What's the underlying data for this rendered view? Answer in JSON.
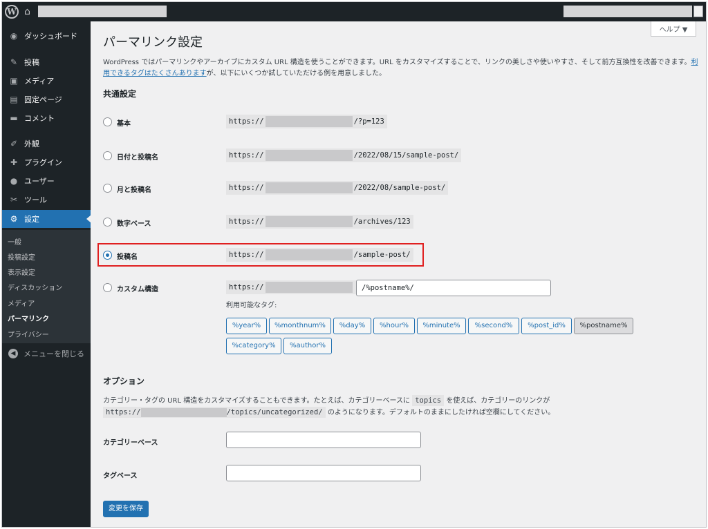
{
  "adminbar": {
    "logo": "W",
    "home_icon": "⌂"
  },
  "sidebar": {
    "items": [
      {
        "icon": "◉",
        "label": "ダッシュボード"
      },
      {
        "icon": "✎",
        "label": "投稿"
      },
      {
        "icon": "▣",
        "label": "メディア"
      },
      {
        "icon": "▤",
        "label": "固定ページ"
      },
      {
        "icon": "▬",
        "label": "コメント"
      },
      {
        "icon": "✐",
        "label": "外観"
      },
      {
        "icon": "✚",
        "label": "プラグイン"
      },
      {
        "icon": "●",
        "label": "ユーザー"
      },
      {
        "icon": "✂",
        "label": "ツール"
      },
      {
        "icon": "⚙",
        "label": "設定"
      }
    ],
    "submenu": [
      "一般",
      "投稿設定",
      "表示設定",
      "ディスカッション",
      "メディア",
      "パーマリンク",
      "プライバシー"
    ],
    "collapse_label": "メニューを閉じる"
  },
  "main": {
    "help_label": "ヘルプ ▼",
    "title": "パーマリンク設定",
    "intro_text": "WordPress ではパーマリンクやアーカイブにカスタム URL 構造を使うことができます。URL をカスタマイズすることで、リンクの美しさや使いやすさ、そして前方互換性を改善できます。",
    "intro_link": "利用できるタグはたくさんあります",
    "intro_suffix": "が、以下にいくつか試していただける例を用意しました。",
    "common_title": "共通設定",
    "permalink_options": [
      {
        "label": "基本",
        "prefix": "https://",
        "suffix": "/?p=123",
        "checked": false
      },
      {
        "label": "日付と投稿名",
        "prefix": "https://",
        "suffix": "/2022/08/15/sample-post/",
        "checked": false
      },
      {
        "label": "月と投稿名",
        "prefix": "https://",
        "suffix": "/2022/08/sample-post/",
        "checked": false
      },
      {
        "label": "数字ベース",
        "prefix": "https://",
        "suffix": "/archives/123",
        "checked": false
      },
      {
        "label": "投稿名",
        "prefix": "https://",
        "suffix": "/sample-post/",
        "checked": true
      },
      {
        "label": "カスタム構造",
        "prefix": "https://",
        "suffix": "",
        "checked": false
      }
    ],
    "custom_value": "/%postname%/",
    "available_tags_label": "利用可能なタグ:",
    "tags": [
      "%year%",
      "%monthnum%",
      "%day%",
      "%hour%",
      "%minute%",
      "%second%",
      "%post_id%",
      "%postname%",
      "%category%",
      "%author%"
    ],
    "active_tag": "%postname%",
    "options_title": "オプション",
    "options_text_1": "カテゴリー・タグの URL 構造をカスタマイズすることもできます。たとえば、カテゴリーベースに",
    "options_code_1": "topics",
    "options_text_2": "を使えば、カテゴリーのリンクが",
    "options_code_prefix": "https://",
    "options_code_suffix": "/topics/uncategorized/",
    "options_text_3": "のようになります。デフォルトのままにしたければ空欄にしてください。",
    "category_base_label": "カテゴリーベース",
    "category_base_value": "",
    "tag_base_label": "タグベース",
    "tag_base_value": "",
    "save_label": "変更を保存"
  },
  "colors": {
    "accent": "#2271b1",
    "sidebar": "#1d2327",
    "highlight": "#e02020"
  }
}
